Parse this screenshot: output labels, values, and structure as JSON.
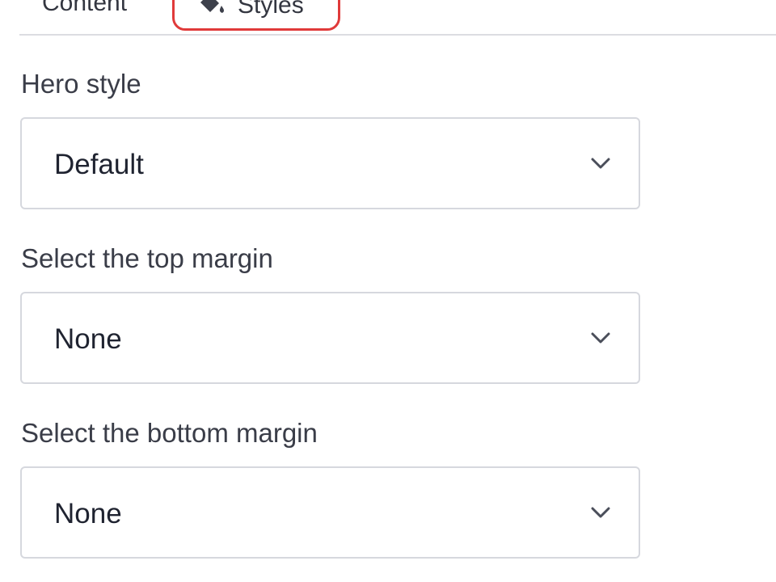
{
  "tabs": {
    "content_label": "Content",
    "styles_label": "Styles",
    "highlight_color": "#e03a3a"
  },
  "fields": {
    "hero_style": {
      "label": "Hero style",
      "value": "Default"
    },
    "top_margin": {
      "label": "Select the top margin",
      "value": "None"
    },
    "bottom_margin": {
      "label": "Select the bottom margin",
      "value": "None"
    }
  },
  "icons": {
    "styles_tab_icon": "paint-bucket-icon",
    "select_chevron": "chevron-down-icon"
  }
}
